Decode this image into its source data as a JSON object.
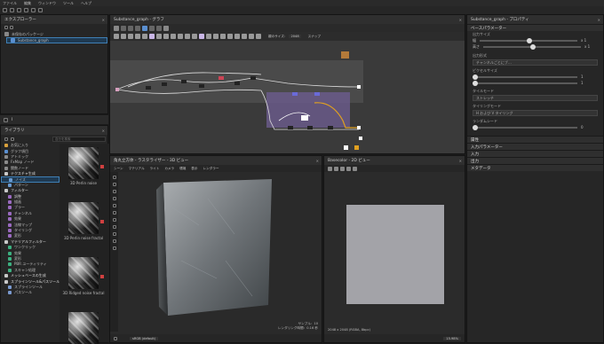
{
  "menu": [
    "ファイル",
    "編集",
    "ウィンドウ",
    "ツール",
    "ヘルプ"
  ],
  "explorer": {
    "title": "エクスプローラー",
    "tree_root": "未保存のパッケージ",
    "graph_item": "Substance_graph"
  },
  "library": {
    "title": "ライブラリ",
    "search_placeholder": "自分を検索",
    "categories": [
      {
        "label": "お気に入り",
        "color": "#d9a13c"
      },
      {
        "label": "グラフ項目",
        "color": "#5a8fd0"
      },
      {
        "label": "アトミック",
        "color": "#8a8a8a"
      },
      {
        "label": "FxMap ノード",
        "color": "#8a8a8a"
      },
      {
        "label": "関数ノード",
        "color": "#8a8a8a"
      },
      {
        "label": "テクスチャ生成",
        "color": "#c9c9c9"
      },
      {
        "label": "ノイズ",
        "color": "#6a9ad0"
      },
      {
        "label": "パターン",
        "color": "#6a9ad0"
      },
      {
        "label": "フィルター",
        "color": "#c9c9c9"
      },
      {
        "label": "調整",
        "color": "#9a6ac0"
      },
      {
        "label": "描画",
        "color": "#9a6ac0"
      },
      {
        "label": "ブラー",
        "color": "#9a6ac0"
      },
      {
        "label": "チャンネル",
        "color": "#9a6ac0"
      },
      {
        "label": "効果",
        "color": "#9a6ac0"
      },
      {
        "label": "法線マップ",
        "color": "#9a6ac0"
      },
      {
        "label": "タイリング",
        "color": "#9a6ac0"
      },
      {
        "label": "変形",
        "color": "#9a6ac0"
      },
      {
        "label": "マテリアルフィルター",
        "color": "#c9c9c9"
      },
      {
        "label": "ワンクリック",
        "color": "#3cb080"
      },
      {
        "label": "効果",
        "color": "#3cb080"
      },
      {
        "label": "変形",
        "color": "#3cb080"
      },
      {
        "label": "PBR ユーティリティ",
        "color": "#3cb080"
      },
      {
        "label": "スキャン処理",
        "color": "#3cb080"
      },
      {
        "label": "メッシュベースの生成",
        "color": "#c9c9c9"
      },
      {
        "label": "スプラインツール&パスツール",
        "color": "#c9c9c9"
      },
      {
        "label": "スプラインツール",
        "color": "#7a9ad0"
      },
      {
        "label": "パスツール",
        "color": "#7a9ad0"
      }
    ],
    "thumbs": [
      "3D Perlin noise",
      "3D Perlin noise fractal",
      "3D Ridged noise fractal",
      ""
    ]
  },
  "graph": {
    "title": "Substance_graph - グラフ",
    "size_label": "親のサイズ：",
    "size_value": "2048",
    "snap_label": "スナップ"
  },
  "viewport3d": {
    "title": "角丸立方体 - ラスタライザー - 3D ビュー",
    "menu": [
      "シーン",
      "マテリアル",
      "ライト",
      "カメラ",
      "環境",
      "表示",
      "レンダラー"
    ],
    "samples": "サンプル：10",
    "render_time": "レンダリング時間：0.16 秒",
    "colorspace": "sRGB (default)"
  },
  "view2d": {
    "title": "Basecolor - 2D ビュー",
    "info": "2048 x 2048 (RGBA, 8bpc)",
    "zoom": "15.98%"
  },
  "properties": {
    "title": "Substance_graph - プロパティ",
    "base_params": "ベースパラメーター",
    "output_size": "出力サイズ",
    "width": "幅",
    "height": "高さ",
    "width_val": "x 1",
    "height_val": "x 1",
    "output_format": "出力形式",
    "output_format_val": "チャンネルごとにブ…",
    "pixel_size": "ピクセルサイズ",
    "pixel_w": "1",
    "pixel_h": "1",
    "tile_mode": "タイルモード",
    "tile_mode_val": "ストレッチ",
    "tiling_mode": "タイリングモード",
    "tiling_mode_val": "H および V タイリング",
    "random_seed": "ランダムシード",
    "random_seed_val": "0",
    "sections": [
      "属性",
      "入力パラメーター",
      "入力",
      "出力",
      "メタデータ"
    ]
  }
}
